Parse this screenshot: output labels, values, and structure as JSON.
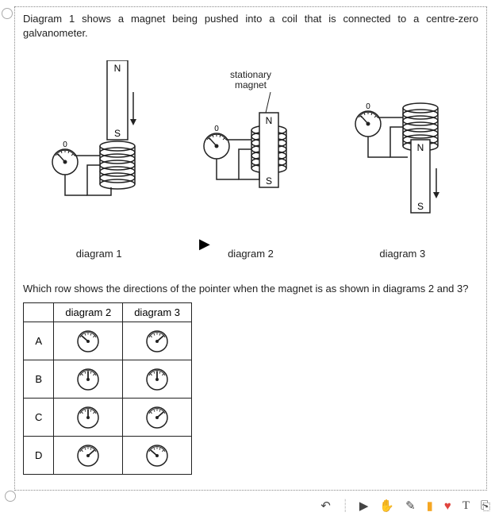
{
  "intro": "Diagram 1 shows a magnet being pushed into a coil that is connected to a centre-zero galvanometer.",
  "stationary_label_line1": "stationary",
  "stationary_label_line2": "magnet",
  "poles": {
    "N": "N",
    "S": "S",
    "zero": "0"
  },
  "captions": {
    "d1": "diagram 1",
    "d2": "diagram 2",
    "d3": "diagram 3"
  },
  "question": "Which row shows the directions of the pointer when the magnet is as shown in diagrams 2 and 3?",
  "table": {
    "headers": {
      "col1": "diagram 2",
      "col2": "diagram 3"
    },
    "rows": [
      {
        "label": "A",
        "p2": "left",
        "p3": "right"
      },
      {
        "label": "B",
        "p2": "center",
        "p3": "center"
      },
      {
        "label": "C",
        "p2": "center",
        "p3": "right"
      },
      {
        "label": "D",
        "p2": "right",
        "p3": "left"
      }
    ]
  },
  "toolbar": {
    "undo": "↶",
    "play": "▶",
    "hand": "✋",
    "pen": "✎",
    "note": "▮",
    "heart": "♥",
    "text": "T",
    "copy": "⎘"
  }
}
